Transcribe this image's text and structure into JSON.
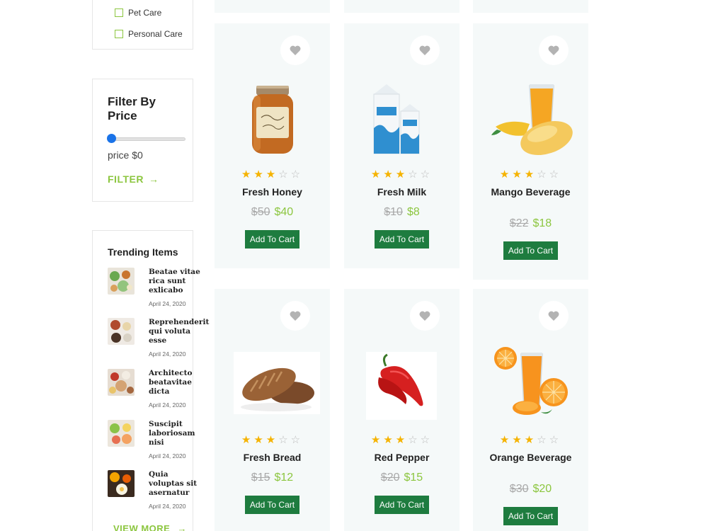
{
  "sidebar": {
    "categories": [
      {
        "label": "Pet Care"
      },
      {
        "label": "Personal Care"
      }
    ],
    "price_filter": {
      "title": "Filter By Price",
      "price_label": "price $0",
      "slider_value": 0,
      "filter_button": "FILTER",
      "arrow_glyph": "→",
      "accent_color": "#8cc63f",
      "thumb_color": "#1a73e8"
    },
    "trending": {
      "title": "Trending Items",
      "items": [
        {
          "title": "Beatae vitae rica sunt exlicabo",
          "date": "April 24, 2020"
        },
        {
          "title": "Reprehenderit qui voluta esse",
          "date": "April 24, 2020"
        },
        {
          "title": "Architecto beatavitae dicta",
          "date": "April 24, 2020"
        },
        {
          "title": "Suscipit laboriosam nisi",
          "date": "April 24, 2020"
        },
        {
          "title": "Quia voluptas sit asernatur",
          "date": "April 24, 2020"
        }
      ],
      "view_more": "VIEW MORE",
      "arrow_glyph": "→"
    }
  },
  "products": [
    {
      "name": "Fresh Honey",
      "old_price": "$50",
      "price": "$40",
      "rating": 3,
      "max_rating": 5,
      "cart_label": "Add To Cart",
      "image": "honey-jar"
    },
    {
      "name": "Fresh Milk",
      "old_price": "$10",
      "price": "$8",
      "rating": 3,
      "max_rating": 5,
      "cart_label": "Add To Cart",
      "image": "milk-cartons"
    },
    {
      "name": "Mango Beverage",
      "old_price": "$22",
      "price": "$18",
      "rating": 3,
      "max_rating": 5,
      "cart_label": "Add To Cart",
      "image": "mango-juice"
    },
    {
      "name": "Fresh Bread",
      "old_price": "$15",
      "price": "$12",
      "rating": 3,
      "max_rating": 5,
      "cart_label": "Add To Cart",
      "image": "bread-loaves"
    },
    {
      "name": "Red Pepper",
      "old_price": "$20",
      "price": "$15",
      "rating": 3,
      "max_rating": 5,
      "cart_label": "Add To Cart",
      "image": "red-pepper"
    },
    {
      "name": "Orange Beverage",
      "old_price": "$30",
      "price": "$20",
      "rating": 3,
      "max_rating": 5,
      "cart_label": "Add To Cart",
      "image": "orange-juice"
    }
  ],
  "icons": {
    "wishlist": "heart-icon",
    "star": "star-icon"
  },
  "colors": {
    "cart_button": "#1e7c3f",
    "new_price": "#8cc63f",
    "star": "#f5b301",
    "card_bg": "#f5f9f9"
  }
}
